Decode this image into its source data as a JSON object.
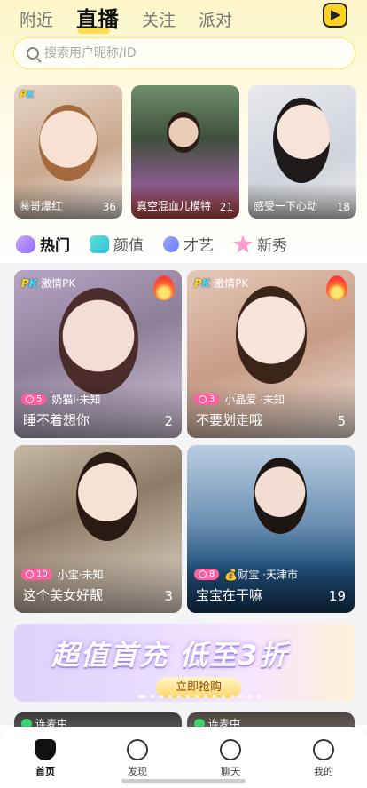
{
  "top_tabs": [
    "附近",
    "直播",
    "关注",
    "派对"
  ],
  "search": {
    "placeholder": "搜索用户昵称/ID"
  },
  "featured": [
    {
      "title": "㊙哥爆红",
      "count": "36",
      "pk": true
    },
    {
      "title": "真空混血儿模特",
      "count": "21",
      "pk": false
    },
    {
      "title": "感受一下心动",
      "count": "18",
      "pk": false
    }
  ],
  "categories": [
    "热门",
    "颜值",
    "才艺",
    "新秀"
  ],
  "cards": [
    {
      "tag": "激情PK",
      "level": "5",
      "user": "奶猫i·未知",
      "title": "睡不着想你",
      "count": "2"
    },
    {
      "tag": "激情PK",
      "level": "3",
      "user": "小晶爱 ·未知",
      "title": "不要划走哦",
      "count": "5"
    },
    {
      "tag": "",
      "level": "10",
      "user": "小宝·未知",
      "title": "这个美女好靓",
      "count": "3"
    },
    {
      "tag": "",
      "level": "8",
      "user": "💰财宝 ·天津市",
      "title": "宝宝在干嘛",
      "count": "19"
    }
  ],
  "banner": {
    "title": "超值首充 低至3折",
    "button": "立即抢购"
  },
  "peek": [
    "连麦中",
    "连麦中"
  ],
  "nav": [
    "首页",
    "发现",
    "聊天",
    "我的"
  ],
  "colors": {
    "accent": "#ffd83a",
    "level_badge": "#ff5fa0",
    "pk_yellow": "#ffe100"
  }
}
